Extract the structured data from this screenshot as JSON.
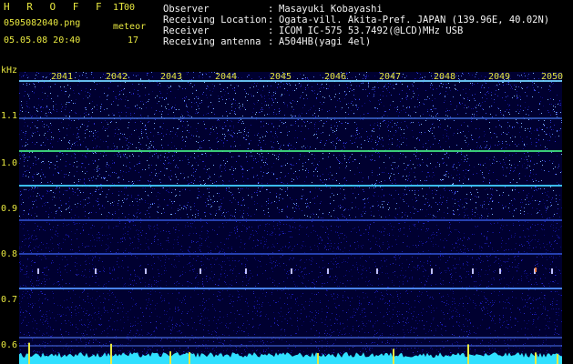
{
  "app": {
    "name": "H R O F F T",
    "version": "1.00"
  },
  "file": {
    "name": "0505082040.png",
    "datetime": "05.05.08 20:40"
  },
  "meteor": {
    "label": "meteor",
    "count": "17"
  },
  "station": [
    {
      "label": "Observer",
      "value": "Masayuki Kobayashi"
    },
    {
      "label": "Receiving Location",
      "value": "Ogata-vill. Akita-Pref. JAPAN (139.96E, 40.02N)"
    },
    {
      "label": "Receiver",
      "value": "ICOM IC-575 53.7492(@LCD)MHz USB"
    },
    {
      "label": "Receiving antenna",
      "value": "A504HB(yagi 4el)"
    }
  ],
  "axis": {
    "unit": "kHz",
    "freq_labels": [
      "1.1",
      "1.0",
      "0.9",
      "0.8",
      "0.7",
      "0.6"
    ],
    "time_labels": [
      "2041",
      "2042",
      "2043",
      "2044",
      "2045",
      "2046",
      "2047",
      "2048",
      "2049",
      "2050"
    ]
  },
  "colors": {
    "label": "#e8e840",
    "background": "#000000",
    "noise": "#0a0a80",
    "carrier": "#40c8ff"
  }
}
